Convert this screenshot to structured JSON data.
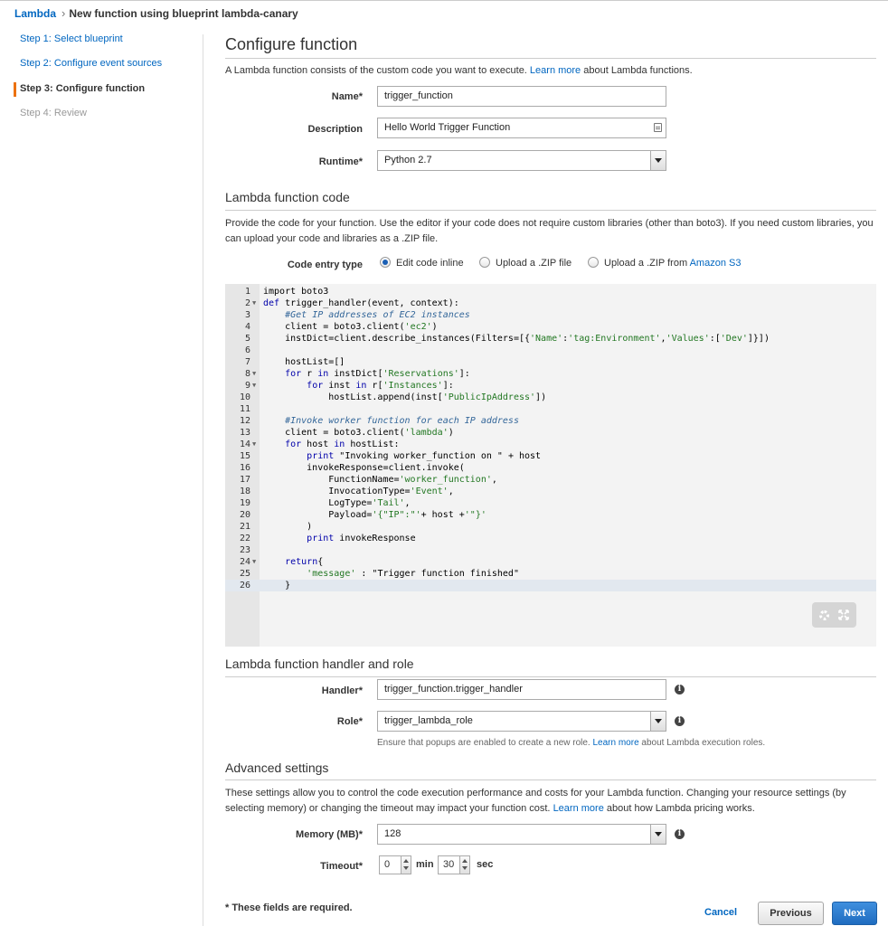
{
  "breadcrumb": {
    "home": "Lambda",
    "current": "New function using blueprint lambda-canary"
  },
  "steps": [
    {
      "label": "Step 1: Select blueprint",
      "state": "link"
    },
    {
      "label": "Step 2: Configure event sources",
      "state": "link"
    },
    {
      "label": "Step 3: Configure function",
      "state": "active"
    },
    {
      "label": "Step 4: Review",
      "state": "disabled"
    }
  ],
  "configure": {
    "title": "Configure function",
    "intro_before": "A Lambda function consists of the custom code you want to execute. ",
    "intro_link": "Learn more",
    "intro_after": " about Lambda functions.",
    "name_label": "Name*",
    "name_value": "trigger_function",
    "description_label": "Description",
    "description_value": "Hello World Trigger Function",
    "runtime_label": "Runtime*",
    "runtime_value": "Python 2.7"
  },
  "code": {
    "title": "Lambda function code",
    "intro": "Provide the code for your function. Use the editor if your code does not require custom libraries (other than boto3). If you need custom libraries, you can upload your code and libraries as a .ZIP file.",
    "entry_label": "Code entry type",
    "options": {
      "inline": "Edit code inline",
      "zip": "Upload a .ZIP file",
      "s3_prefix": "Upload a .ZIP from ",
      "s3_link": "Amazon S3"
    },
    "selected_option": "inline",
    "lines": [
      {
        "n": "1",
        "fold": false,
        "html": "import boto3"
      },
      {
        "n": "2",
        "fold": true,
        "html": "<span class=\"kw\">def</span> trigger_handler(event, context):"
      },
      {
        "n": "3",
        "fold": false,
        "html": "    <span class=\"cmt\">#Get IP addresses of EC2 instances</span>"
      },
      {
        "n": "4",
        "fold": false,
        "html": "    client = boto3.client(<span class=\"str\">'ec2'</span>)"
      },
      {
        "n": "5",
        "fold": false,
        "html": "    instDict=client.describe_instances(Filters=[{<span class=\"str\">'Name'</span>:<span class=\"str\">'tag:Environment'</span>,<span class=\"str\">'Values'</span>:[<span class=\"str\">'Dev'</span>]}])"
      },
      {
        "n": "6",
        "fold": false,
        "html": ""
      },
      {
        "n": "7",
        "fold": false,
        "html": "    hostList=[]"
      },
      {
        "n": "8",
        "fold": true,
        "html": "    <span class=\"kw\">for</span> r <span class=\"kw\">in</span> instDict[<span class=\"str\">'Reservations'</span>]:"
      },
      {
        "n": "9",
        "fold": true,
        "html": "        <span class=\"kw\">for</span> inst <span class=\"kw\">in</span> r[<span class=\"str\">'Instances'</span>]:"
      },
      {
        "n": "10",
        "fold": false,
        "html": "            hostList.append(inst[<span class=\"str\">'PublicIpAddress'</span>])"
      },
      {
        "n": "11",
        "fold": false,
        "html": ""
      },
      {
        "n": "12",
        "fold": false,
        "html": "    <span class=\"cmt\">#Invoke worker function for each IP address</span>"
      },
      {
        "n": "13",
        "fold": false,
        "html": "    client = boto3.client(<span class=\"str\">'lambda'</span>)"
      },
      {
        "n": "14",
        "fold": true,
        "html": "    <span class=\"kw\">for</span> host <span class=\"kw\">in</span> hostList:"
      },
      {
        "n": "15",
        "fold": false,
        "html": "        <span class=\"kw\">print</span> \"Invoking worker_function on \" + host"
      },
      {
        "n": "16",
        "fold": false,
        "html": "        invokeResponse=client.invoke("
      },
      {
        "n": "17",
        "fold": false,
        "html": "            FunctionName=<span class=\"str\">'worker_function'</span>,"
      },
      {
        "n": "18",
        "fold": false,
        "html": "            InvocationType=<span class=\"str\">'Event'</span>,"
      },
      {
        "n": "19",
        "fold": false,
        "html": "            LogType=<span class=\"str\">'Tail'</span>,"
      },
      {
        "n": "20",
        "fold": false,
        "html": "            Payload=<span class=\"str\">'{\"IP\":\"'</span>+ host +<span class=\"str\">'\"}'</span>"
      },
      {
        "n": "21",
        "fold": false,
        "html": "        )"
      },
      {
        "n": "22",
        "fold": false,
        "html": "        <span class=\"kw\">print</span> invokeResponse"
      },
      {
        "n": "23",
        "fold": false,
        "html": ""
      },
      {
        "n": "24",
        "fold": true,
        "html": "    <span class=\"kw\">return</span>{"
      },
      {
        "n": "25",
        "fold": false,
        "html": "        <span class=\"str\">'message'</span> : \"Trigger function finished\""
      },
      {
        "n": "26",
        "fold": false,
        "html": "    }"
      }
    ],
    "active_line": "26"
  },
  "handler": {
    "title": "Lambda function handler and role",
    "handler_label": "Handler*",
    "handler_value": "trigger_function.trigger_handler",
    "role_label": "Role*",
    "role_value": "trigger_lambda_role",
    "hint_before": "Ensure that popups are enabled to create a new role. ",
    "hint_link": "Learn more",
    "hint_after": " about Lambda execution roles."
  },
  "advanced": {
    "title": "Advanced settings",
    "intro_before": "These settings allow you to control the code execution performance and costs for your Lambda function. Changing your resource settings (by selecting memory) or changing the timeout may impact your function cost. ",
    "intro_link": "Learn more",
    "intro_after": " about how Lambda pricing works.",
    "memory_label": "Memory (MB)*",
    "memory_value": "128",
    "timeout_label": "Timeout*",
    "timeout_min": "0",
    "min_unit": "min",
    "timeout_sec": "30",
    "sec_unit": "sec"
  },
  "footer": {
    "required_note": "* These fields are required.",
    "cancel": "Cancel",
    "previous": "Previous",
    "next": "Next"
  }
}
